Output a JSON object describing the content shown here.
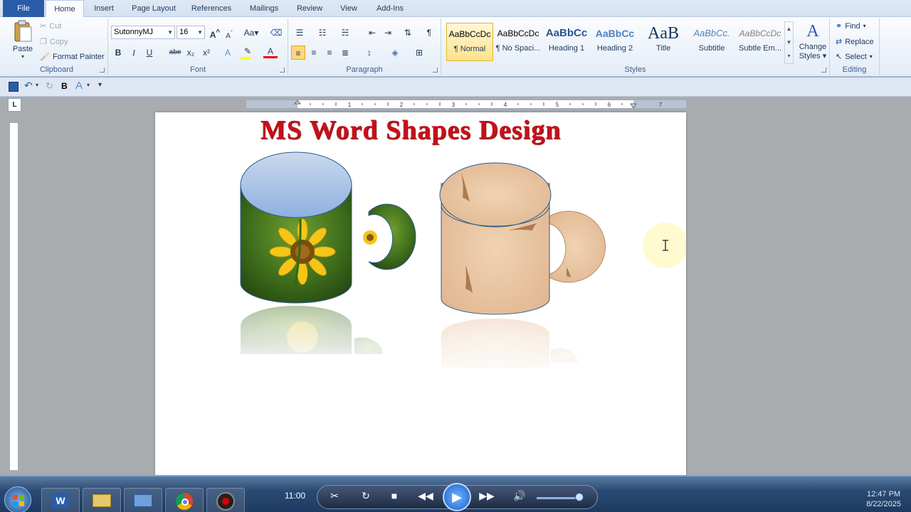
{
  "tabs": [
    {
      "label": "File",
      "active": false
    },
    {
      "label": "Home",
      "active": true
    },
    {
      "label": "Insert",
      "active": false
    },
    {
      "label": "Page Layout",
      "active": false
    },
    {
      "label": "References",
      "active": false
    },
    {
      "label": "Mailings",
      "active": false
    },
    {
      "label": "Review",
      "active": false
    },
    {
      "label": "View",
      "active": false
    },
    {
      "label": "Add-Ins",
      "active": false
    }
  ],
  "clipboard": {
    "paste": "Paste",
    "cut": "Cut",
    "copy": "Copy",
    "format_painter": "Format Painter",
    "label": "Clipboard"
  },
  "font": {
    "family": "SutonnyMJ",
    "size": "16",
    "label": "Font",
    "buttons": [
      "A",
      "A",
      "Aa",
      "B",
      "I",
      "U",
      "abe",
      "x₂",
      "x²",
      "A",
      "A"
    ]
  },
  "paragraph": {
    "label": "Paragraph"
  },
  "styles": {
    "label": "Styles",
    "items": [
      {
        "sample": "AaBbCcDc",
        "name": "¶ Normal",
        "selected": true
      },
      {
        "sample": "AaBbCcDc",
        "name": "¶ No Spaci...",
        "selected": false
      },
      {
        "sample": "AaBbCc",
        "name": "Heading 1",
        "selected": false
      },
      {
        "sample": "AaBbCc",
        "name": "Heading 2",
        "selected": false
      },
      {
        "sample": "AaB",
        "name": "Title",
        "selected": false
      },
      {
        "sample": "AaBbCc.",
        "name": "Subtitle",
        "selected": false
      },
      {
        "sample": "AaBbCcDc",
        "name": "Subtle Em...",
        "selected": false
      }
    ],
    "change_styles_1": "Change",
    "change_styles_2": "Styles"
  },
  "editing": {
    "label": "Editing",
    "find": "Find",
    "replace": "Replace",
    "select": "Select"
  },
  "document": {
    "title": "MS Word Shapes Design"
  },
  "player": {
    "time": "11:00"
  },
  "clock": {
    "time": "12:47 PM",
    "date": "8/22/2025"
  },
  "colors": {
    "title_red": "#c8101a",
    "file_tab": "#2a5ca8",
    "taskbar": "#1e3a60"
  }
}
